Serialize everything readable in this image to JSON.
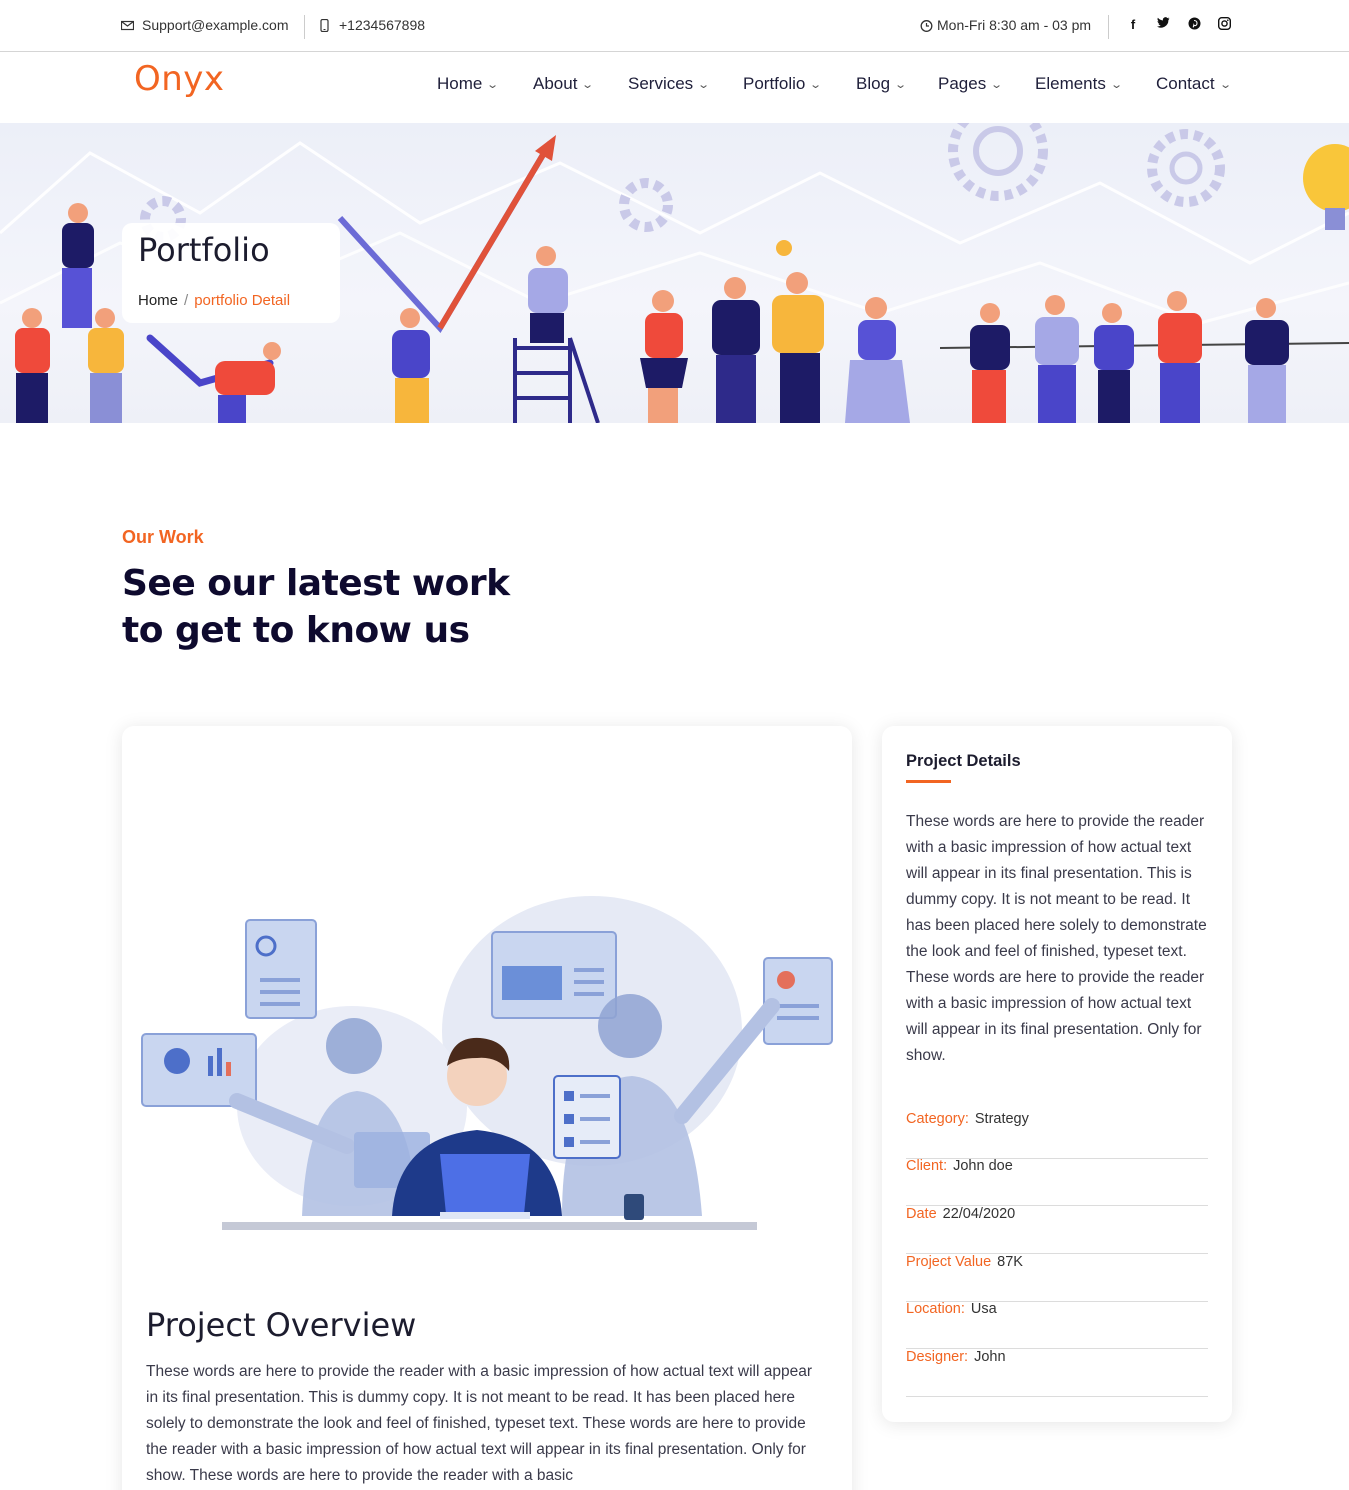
{
  "topbar": {
    "email": "Support@example.com",
    "phone": "+1234567898",
    "hours": "Mon-Fri 8:30 am - 03 pm",
    "socials": [
      {
        "icon": "facebook-icon",
        "glyph": "f"
      },
      {
        "icon": "twitter-icon",
        "glyph": "t"
      },
      {
        "icon": "pinterest-icon",
        "glyph": "p"
      },
      {
        "icon": "instagram-icon",
        "glyph": "◎"
      }
    ]
  },
  "nav": {
    "logo": "Onyx",
    "items": [
      {
        "label": "Home"
      },
      {
        "label": "About"
      },
      {
        "label": "Services"
      },
      {
        "label": "Portfolio"
      },
      {
        "label": "Blog"
      },
      {
        "label": "Pages"
      },
      {
        "label": "Elements"
      },
      {
        "label": "Contact"
      }
    ]
  },
  "hero": {
    "title": "Portfolio",
    "crumb_home": "Home",
    "crumb_sep": "/",
    "crumb_current": "portfolio Detail"
  },
  "section": {
    "eyebrow": "Our Work",
    "heading": "See our latest work to get to know us"
  },
  "main": {
    "overview_title": "Project Overview",
    "overview_text": "These words are here to provide the reader with a basic impression of how actual text will appear in its final presentation. This is dummy copy. It is not meant to be read. It has been placed here solely to demonstrate the look and feel of finished, typeset text. These words are here to provide the reader with a basic impression of how actual text will appear in its final presentation. Only for show. These words are here to provide the reader with a basic"
  },
  "details": {
    "title": "Project Details",
    "text": "These words are here to provide the reader with a basic impression of how actual text will appear in its final presentation. This is dummy copy. It is not meant to be read. It has been placed here solely to demonstrate the look and feel of finished, typeset text. These words are here to provide the reader with a basic impression of how actual text will appear in its final presentation. Only for show.",
    "rows": [
      {
        "key": "Category:",
        "value": "Strategy"
      },
      {
        "key": "Client:",
        "value": "John doe"
      },
      {
        "key": "Date",
        "value": "22/04/2020"
      },
      {
        "key": "Project Value",
        "value": "87K"
      },
      {
        "key": "Location:",
        "value": "Usa"
      },
      {
        "key": "Designer:",
        "value": "John"
      }
    ]
  },
  "colors": {
    "accent": "#f26522",
    "heading": "#0e0a2e",
    "illustration_blue": "#3b5bdb"
  }
}
